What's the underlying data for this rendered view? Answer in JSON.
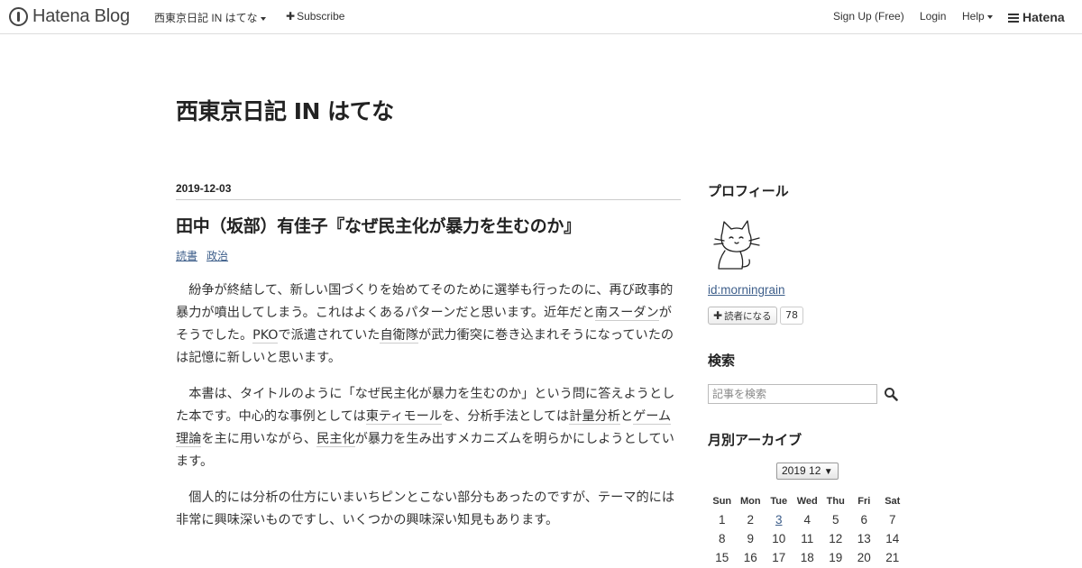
{
  "header": {
    "logo_text": "Hatena Blog",
    "blog_menu_label": "西東京日記 IN はてな",
    "subscribe_label": "Subscribe",
    "signup_label": "Sign Up (Free)",
    "login_label": "Login",
    "help_label": "Help",
    "hatena_label": "Hatena"
  },
  "blog": {
    "title": "西東京日記 IN はてな"
  },
  "entry": {
    "date": "2019-12-03",
    "title": "田中（坂部）有佳子『なぜ民主化が暴力を生むのか』",
    "categories": [
      "読書",
      "政治"
    ],
    "paragraphs": [
      {
        "pre": "紛争が終結して、新しい国づくりを始めてそのために選挙も行ったのに、再び政事的暴力が噴出してしまう。これはよくあるパターンだと思います。近年だと",
        "kw1": "南スーダン",
        "mid1": "がそうでした。",
        "kw2": "PKO",
        "mid2": "で派遣されていた",
        "kw3": "自衛隊",
        "post": "が武力衝突に巻き込まれそうになっていたのは記憶に新しいと思います。"
      },
      {
        "pre": "本書は、タイトルのように「なぜ民主化が暴力を生むのか」という問に答えようとした本です。中心的な事例としては",
        "kw1": "東ティモール",
        "mid1": "を、分析手法としては",
        "kw2": "計量分析",
        "mid2": "と",
        "kw3": "ゲーム理論",
        "mid3": "を主に用いながら、",
        "kw4": "民主化",
        "post": "が暴力を生み出すメカニズムを明らかにしようとしています。"
      },
      {
        "text": "個人的には分析の仕方にいまいちピンとこない部分もあったのですが、テーマ的には非常に興味深いものですし、いくつかの興味深い知見もあります。"
      }
    ]
  },
  "sidebar": {
    "profile_heading": "プロフィール",
    "profile_id": "id:morningrain",
    "reader_button_label": "読者になる",
    "reader_count": "78",
    "search_heading": "検索",
    "search_placeholder": "記事を検索",
    "archive_heading": "月別アーカイブ",
    "archive_selected": "2019 12",
    "calendar": {
      "weekdays": [
        "Sun",
        "Mon",
        "Tue",
        "Wed",
        "Thu",
        "Fri",
        "Sat"
      ],
      "weeks": [
        [
          "1",
          "2",
          "3",
          "4",
          "5",
          "6",
          "7"
        ],
        [
          "8",
          "9",
          "10",
          "11",
          "12",
          "13",
          "14"
        ],
        [
          "15",
          "16",
          "17",
          "18",
          "19",
          "20",
          "21"
        ]
      ],
      "linked_day": "3"
    }
  },
  "icons": {
    "logo": "hatena-blog-logo-icon",
    "subscribe": "plus-icon",
    "caret": "caret-down-icon",
    "hatena": "hatena-logo-icon",
    "search": "search-icon"
  }
}
